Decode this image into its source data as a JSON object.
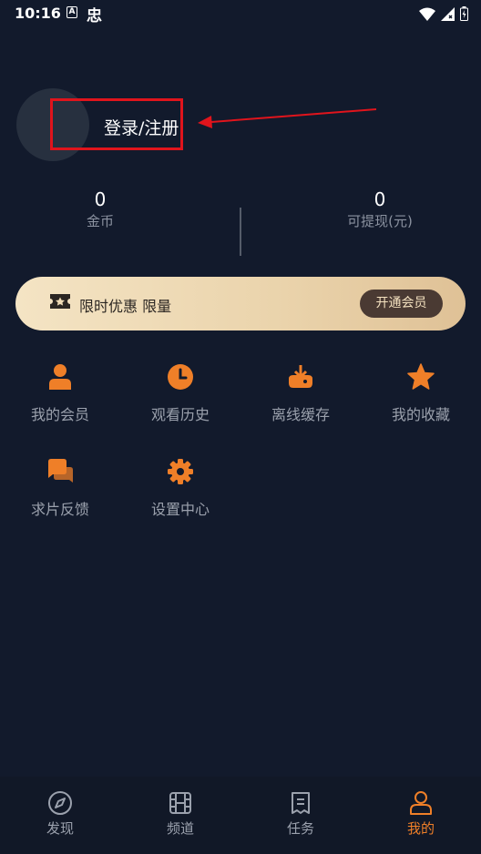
{
  "status_bar": {
    "time": "10:16",
    "icon_a": "A",
    "icon_b": "忠"
  },
  "profile": {
    "login_label": "登录/注册"
  },
  "stats": [
    {
      "value": "0",
      "label": "金币"
    },
    {
      "value": "0",
      "label": "可提现(元)"
    }
  ],
  "vip": {
    "text": "限时优惠 限量",
    "button": "开通会员"
  },
  "menu": [
    {
      "label": "我的会员",
      "icon": "user-icon"
    },
    {
      "label": "观看历史",
      "icon": "clock-icon"
    },
    {
      "label": "离线缓存",
      "icon": "download-icon"
    },
    {
      "label": "我的收藏",
      "icon": "star-icon"
    },
    {
      "label": "求片反馈",
      "icon": "chat-icon"
    },
    {
      "label": "设置中心",
      "icon": "gear-icon"
    }
  ],
  "nav": [
    {
      "label": "发现",
      "icon": "compass-icon",
      "active": false
    },
    {
      "label": "频道",
      "icon": "film-icon",
      "active": false
    },
    {
      "label": "任务",
      "icon": "task-icon",
      "active": false
    },
    {
      "label": "我的",
      "icon": "profile-icon",
      "active": true
    }
  ],
  "colors": {
    "accent": "#ef7f28",
    "background": "#121a2c",
    "annotation": "#e0141c"
  }
}
